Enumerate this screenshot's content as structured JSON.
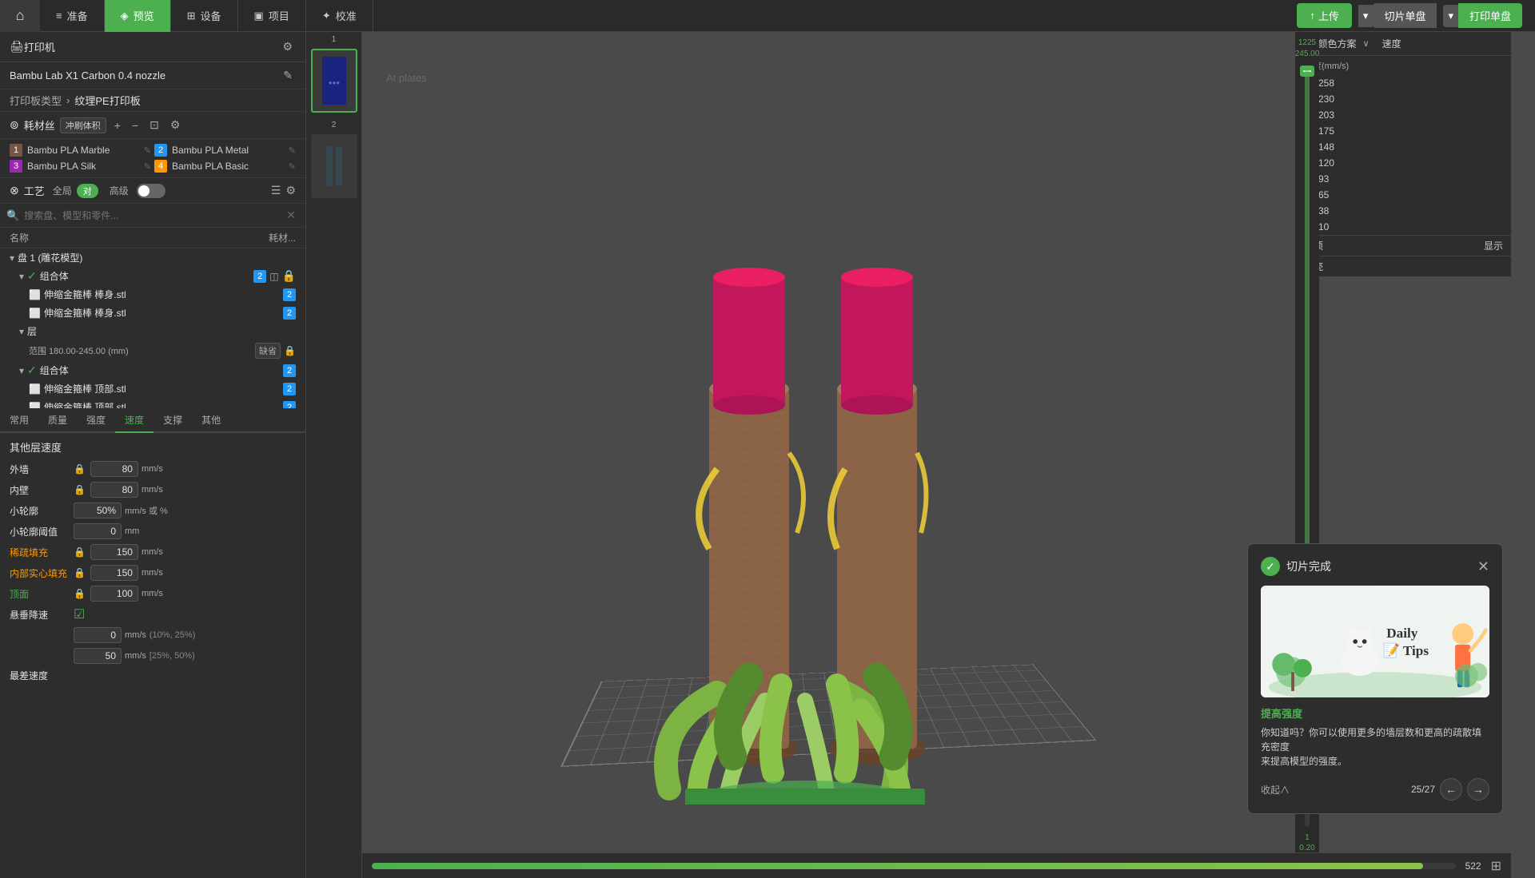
{
  "nav": {
    "home_icon": "⌂",
    "tabs": [
      {
        "label": "准备",
        "icon": "≡",
        "active": false
      },
      {
        "label": "预览",
        "icon": "◈",
        "active": true
      },
      {
        "label": "设备",
        "icon": "⊞",
        "active": false
      },
      {
        "label": "项目",
        "icon": "▣",
        "active": false
      },
      {
        "label": "校准",
        "icon": "✦",
        "active": false
      }
    ],
    "buttons": {
      "upload": "上传",
      "slice_plate": "切片单盘",
      "print_plate": "打印单盘"
    }
  },
  "left_panel": {
    "printer_section": {
      "title": "打印机",
      "name": "Bambu Lab X1 Carbon 0.4 nozzle",
      "plate_type_label": "打印板类型",
      "plate_type": "纹理PE打印板"
    },
    "filament_section": {
      "title": "耗材丝",
      "badge": "冲刷体积",
      "items": [
        {
          "num": "1",
          "name": "Bambu PLA Marble",
          "color": "#a0522d"
        },
        {
          "num": "2",
          "name": "Bambu PLA Metal",
          "color": "#2196F3"
        },
        {
          "num": "3",
          "name": "Bambu PLA Silk",
          "color": "#9C27B0"
        },
        {
          "num": "4",
          "name": "Bambu PLA Basic",
          "color": "#FF9800"
        }
      ]
    },
    "craft_section": {
      "title": "工艺",
      "badge": "全局",
      "badge_active": "对",
      "advanced_label": "高级",
      "search_placeholder": "搜索盘、模型和零件..."
    },
    "tree": {
      "col_name": "名称",
      "col_material": "耗材...",
      "items": [
        {
          "level": 0,
          "label": "盘 1 (雕花模型)",
          "type": "disk"
        },
        {
          "level": 1,
          "label": "组合体",
          "type": "group",
          "check": true,
          "num": "2",
          "extra": "◫"
        },
        {
          "level": 2,
          "label": "伸缩金箍棒 棒身.stl",
          "type": "file",
          "num": "2"
        },
        {
          "level": 2,
          "label": "伸缩金箍棒 棒身.stl",
          "type": "file",
          "num": "2"
        },
        {
          "level": 1,
          "label": "层",
          "type": "layer"
        },
        {
          "level": 2,
          "label": "范围 180.00-245.00 (mm)",
          "type": "range",
          "badge": "缺省",
          "lock": true
        },
        {
          "level": 1,
          "label": "组合体",
          "type": "group",
          "check": true,
          "num": "2"
        },
        {
          "level": 2,
          "label": "伸缩金箍棒 顶部.stl",
          "type": "file",
          "num": "2"
        },
        {
          "level": 2,
          "label": "伸缩金箍棒 顶部.stl",
          "type": "file",
          "num": "2"
        }
      ]
    },
    "tabs": [
      "常用",
      "质量",
      "强度",
      "速度",
      "支撑",
      "其他"
    ],
    "active_tab": "速度",
    "speed_section": {
      "title": "其他层速度",
      "items": [
        {
          "label": "外墙",
          "locked": true,
          "value": "80",
          "unit": "mm/s",
          "color": "normal"
        },
        {
          "label": "内壁",
          "locked": true,
          "value": "80",
          "unit": "mm/s",
          "color": "normal"
        },
        {
          "label": "小轮廓",
          "locked": false,
          "value": "50%",
          "unit": "mm/s 或 %",
          "color": "normal"
        },
        {
          "label": "小轮廓阈值",
          "locked": false,
          "value": "0",
          "unit": "mm",
          "color": "normal"
        },
        {
          "label": "稀疏填充",
          "locked": true,
          "value": "150",
          "unit": "mm/s",
          "color": "orange"
        },
        {
          "label": "内部实心填充",
          "locked": true,
          "value": "150",
          "unit": "mm/s",
          "color": "orange"
        },
        {
          "label": "顶面",
          "locked": true,
          "value": "100",
          "unit": "mm/s",
          "color": "green"
        },
        {
          "label": "悬垂降速",
          "locked": false,
          "value": "",
          "unit": "",
          "color": "normal",
          "checkbox": true
        }
      ],
      "overhang_items": [
        {
          "value": "0",
          "unit": "mm/s",
          "note": "(10%, 25%)"
        },
        {
          "value": "50",
          "unit": "mm/s",
          "note": "[25%, 50%)"
        }
      ],
      "bottom_label": "最差速度"
    }
  },
  "color_panel": {
    "title": "颜色方案",
    "speed_label": "速度",
    "speed_unit_label": "速度(mm/s)",
    "items": [
      {
        "value": "258",
        "color": "#8BC34A"
      },
      {
        "value": "230",
        "color": "#CDDC39"
      },
      {
        "value": "203",
        "color": "#FFEB3B"
      },
      {
        "value": "175",
        "color": "#FFC107"
      },
      {
        "value": "148",
        "color": "#FF9800"
      },
      {
        "value": "120",
        "color": "#FF6F00"
      },
      {
        "value": "93",
        "color": "#FF5722"
      },
      {
        "value": "65",
        "color": "#F44336"
      },
      {
        "value": "38",
        "color": "#E91E63"
      },
      {
        "value": "10",
        "color": "#9C27B0"
      }
    ],
    "footer_left": "选项",
    "footer_right": "显示",
    "footer_empty": "空壳"
  },
  "ruler": {
    "top_value": "1225",
    "bottom_value": "245.00",
    "layer_value": "1",
    "layer_height": "0.20"
  },
  "slice_dialog": {
    "title": "切片完成",
    "tips_title": "Daily Tips",
    "link_text": "提高强度",
    "description": "你知道吗？你可以使用更多的墙层数和更高的疏散填充密度\n来提高模型的强度。",
    "collapse": "收起∧",
    "page_info": "25/27",
    "prev": "←",
    "next": "→"
  },
  "bottom_bar": {
    "progress_percent": 97,
    "layer_value": "522"
  },
  "thumbnails": [
    {
      "num": "1",
      "active": true
    },
    {
      "num": "2",
      "active": false
    }
  ]
}
